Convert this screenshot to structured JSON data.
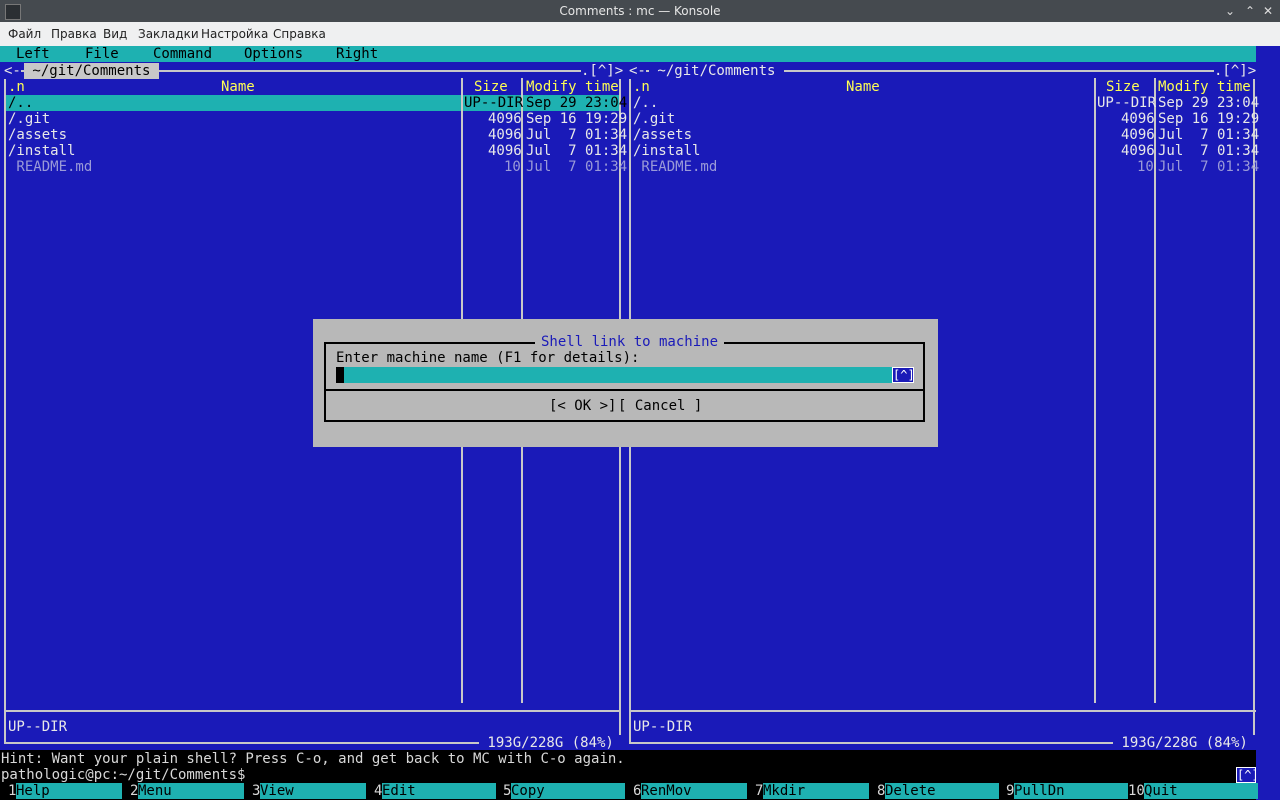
{
  "window": {
    "title": "Comments : mc — Konsole",
    "controls": [
      "chevron-down-icon",
      "chevron-up-icon",
      "close-icon"
    ]
  },
  "konsole_menu": [
    "Файл",
    "Правка",
    "Вид",
    "Закладки",
    "Настройка",
    "Справка"
  ],
  "mc_menu": [
    "Left",
    "File",
    "Command",
    "Options",
    "Right"
  ],
  "left_panel": {
    "nav_left": "<-",
    "path": " ~/git/Comments ",
    "corner": ".[^]>",
    "headers": {
      "sort": ".n",
      "name": "Name",
      "size": "Size",
      "mtime": "Modify time"
    },
    "rows": [
      {
        "name": "/..",
        "size": "UP--DIR",
        "mtime": "Sep 29 23:04"
      },
      {
        "name": "/.git",
        "size": "4096",
        "mtime": "Sep 16 19:29"
      },
      {
        "name": "/assets",
        "size": "4096",
        "mtime": "Jul  7 01:34"
      },
      {
        "name": "/install",
        "size": "4096",
        "mtime": "Jul  7 01:34"
      },
      {
        "name": " README.md",
        "size": "10",
        "mtime": "Jul  7 01:34"
      }
    ],
    "mini_status": "UP--DIR",
    "free_space": " 193G/228G (84%) "
  },
  "right_panel": {
    "nav_left": "<-",
    "path": " ~/git/Comments ",
    "corner": ".[^]>",
    "headers": {
      "sort": ".n",
      "name": "Name",
      "size": "Size",
      "mtime": "Modify time"
    },
    "rows": [
      {
        "name": "/..",
        "size": "UP--DIR",
        "mtime": "Sep 29 23:04"
      },
      {
        "name": "/.git",
        "size": "4096",
        "mtime": "Sep 16 19:29"
      },
      {
        "name": "/assets",
        "size": "4096",
        "mtime": "Jul  7 01:34"
      },
      {
        "name": "/install",
        "size": "4096",
        "mtime": "Jul  7 01:34"
      },
      {
        "name": " README.md",
        "size": "10",
        "mtime": "Jul  7 01:34"
      }
    ],
    "mini_status": "UP--DIR",
    "free_space": " 193G/228G (84%) "
  },
  "dialog": {
    "title": "Shell link to machine",
    "prompt": "Enter machine name (F1 for details):",
    "input_value": "",
    "history_button": "[^]",
    "ok_label": "[< OK >]",
    "cancel_label": "[ Cancel ]"
  },
  "hint": "Hint: Want your plain shell? Press C-o, and get back to MC with C-o again.",
  "prompt": "pathologic@pc:~/git/Comments$",
  "cmd_history": "[^]",
  "fkeys": [
    {
      "num": "1",
      "label": "Help"
    },
    {
      "num": "2",
      "label": "Menu"
    },
    {
      "num": "3",
      "label": "View"
    },
    {
      "num": "4",
      "label": "Edit"
    },
    {
      "num": "5",
      "label": "Copy"
    },
    {
      "num": "6",
      "label": "RenMov"
    },
    {
      "num": "7",
      "label": "Mkdir"
    },
    {
      "num": "8",
      "label": "Delete"
    },
    {
      "num": "9",
      "label": "PullDn"
    },
    {
      "num": "10",
      "label": "Quit"
    }
  ],
  "colors": {
    "panel_bg": "#1a1ab8",
    "cyan": "#1eb1b1",
    "header_yellow": "#ffff54",
    "dialog_bg": "#b8b8b8"
  }
}
